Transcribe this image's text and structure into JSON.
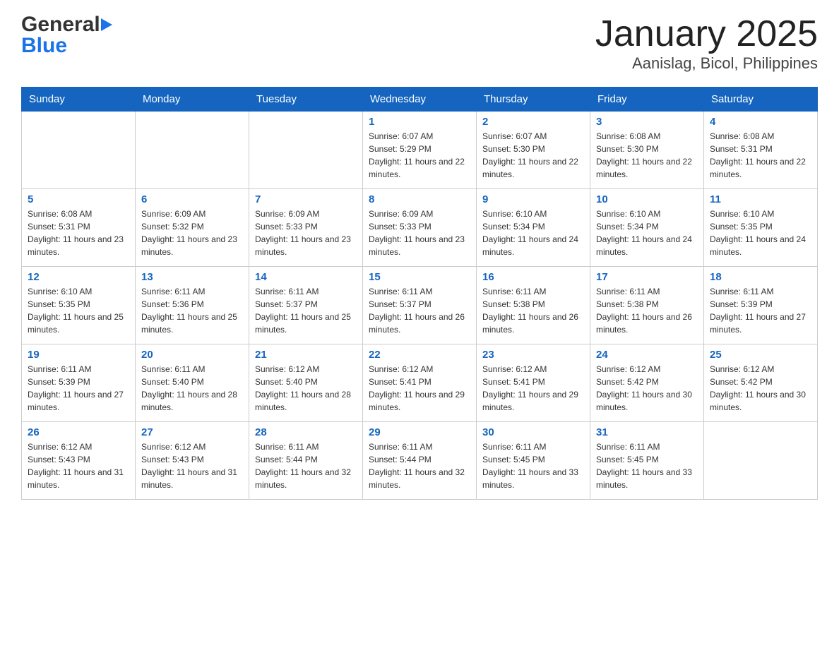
{
  "header": {
    "logo_general": "General",
    "logo_blue": "Blue",
    "month_title": "January 2025",
    "location": "Aanislag, Bicol, Philippines"
  },
  "days_of_week": [
    "Sunday",
    "Monday",
    "Tuesday",
    "Wednesday",
    "Thursday",
    "Friday",
    "Saturday"
  ],
  "weeks": [
    [
      {
        "day": "",
        "info": ""
      },
      {
        "day": "",
        "info": ""
      },
      {
        "day": "",
        "info": ""
      },
      {
        "day": "1",
        "info": "Sunrise: 6:07 AM\nSunset: 5:29 PM\nDaylight: 11 hours and 22 minutes."
      },
      {
        "day": "2",
        "info": "Sunrise: 6:07 AM\nSunset: 5:30 PM\nDaylight: 11 hours and 22 minutes."
      },
      {
        "day": "3",
        "info": "Sunrise: 6:08 AM\nSunset: 5:30 PM\nDaylight: 11 hours and 22 minutes."
      },
      {
        "day": "4",
        "info": "Sunrise: 6:08 AM\nSunset: 5:31 PM\nDaylight: 11 hours and 22 minutes."
      }
    ],
    [
      {
        "day": "5",
        "info": "Sunrise: 6:08 AM\nSunset: 5:31 PM\nDaylight: 11 hours and 23 minutes."
      },
      {
        "day": "6",
        "info": "Sunrise: 6:09 AM\nSunset: 5:32 PM\nDaylight: 11 hours and 23 minutes."
      },
      {
        "day": "7",
        "info": "Sunrise: 6:09 AM\nSunset: 5:33 PM\nDaylight: 11 hours and 23 minutes."
      },
      {
        "day": "8",
        "info": "Sunrise: 6:09 AM\nSunset: 5:33 PM\nDaylight: 11 hours and 23 minutes."
      },
      {
        "day": "9",
        "info": "Sunrise: 6:10 AM\nSunset: 5:34 PM\nDaylight: 11 hours and 24 minutes."
      },
      {
        "day": "10",
        "info": "Sunrise: 6:10 AM\nSunset: 5:34 PM\nDaylight: 11 hours and 24 minutes."
      },
      {
        "day": "11",
        "info": "Sunrise: 6:10 AM\nSunset: 5:35 PM\nDaylight: 11 hours and 24 minutes."
      }
    ],
    [
      {
        "day": "12",
        "info": "Sunrise: 6:10 AM\nSunset: 5:35 PM\nDaylight: 11 hours and 25 minutes."
      },
      {
        "day": "13",
        "info": "Sunrise: 6:11 AM\nSunset: 5:36 PM\nDaylight: 11 hours and 25 minutes."
      },
      {
        "day": "14",
        "info": "Sunrise: 6:11 AM\nSunset: 5:37 PM\nDaylight: 11 hours and 25 minutes."
      },
      {
        "day": "15",
        "info": "Sunrise: 6:11 AM\nSunset: 5:37 PM\nDaylight: 11 hours and 26 minutes."
      },
      {
        "day": "16",
        "info": "Sunrise: 6:11 AM\nSunset: 5:38 PM\nDaylight: 11 hours and 26 minutes."
      },
      {
        "day": "17",
        "info": "Sunrise: 6:11 AM\nSunset: 5:38 PM\nDaylight: 11 hours and 26 minutes."
      },
      {
        "day": "18",
        "info": "Sunrise: 6:11 AM\nSunset: 5:39 PM\nDaylight: 11 hours and 27 minutes."
      }
    ],
    [
      {
        "day": "19",
        "info": "Sunrise: 6:11 AM\nSunset: 5:39 PM\nDaylight: 11 hours and 27 minutes."
      },
      {
        "day": "20",
        "info": "Sunrise: 6:11 AM\nSunset: 5:40 PM\nDaylight: 11 hours and 28 minutes."
      },
      {
        "day": "21",
        "info": "Sunrise: 6:12 AM\nSunset: 5:40 PM\nDaylight: 11 hours and 28 minutes."
      },
      {
        "day": "22",
        "info": "Sunrise: 6:12 AM\nSunset: 5:41 PM\nDaylight: 11 hours and 29 minutes."
      },
      {
        "day": "23",
        "info": "Sunrise: 6:12 AM\nSunset: 5:41 PM\nDaylight: 11 hours and 29 minutes."
      },
      {
        "day": "24",
        "info": "Sunrise: 6:12 AM\nSunset: 5:42 PM\nDaylight: 11 hours and 30 minutes."
      },
      {
        "day": "25",
        "info": "Sunrise: 6:12 AM\nSunset: 5:42 PM\nDaylight: 11 hours and 30 minutes."
      }
    ],
    [
      {
        "day": "26",
        "info": "Sunrise: 6:12 AM\nSunset: 5:43 PM\nDaylight: 11 hours and 31 minutes."
      },
      {
        "day": "27",
        "info": "Sunrise: 6:12 AM\nSunset: 5:43 PM\nDaylight: 11 hours and 31 minutes."
      },
      {
        "day": "28",
        "info": "Sunrise: 6:11 AM\nSunset: 5:44 PM\nDaylight: 11 hours and 32 minutes."
      },
      {
        "day": "29",
        "info": "Sunrise: 6:11 AM\nSunset: 5:44 PM\nDaylight: 11 hours and 32 minutes."
      },
      {
        "day": "30",
        "info": "Sunrise: 6:11 AM\nSunset: 5:45 PM\nDaylight: 11 hours and 33 minutes."
      },
      {
        "day": "31",
        "info": "Sunrise: 6:11 AM\nSunset: 5:45 PM\nDaylight: 11 hours and 33 minutes."
      },
      {
        "day": "",
        "info": ""
      }
    ]
  ]
}
